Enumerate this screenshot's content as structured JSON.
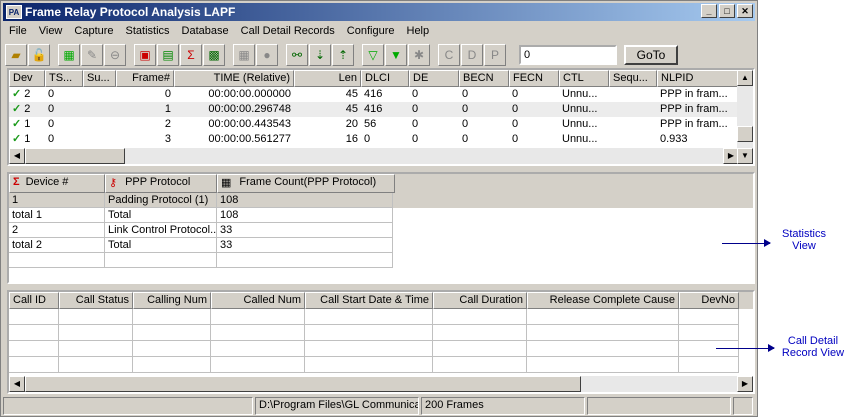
{
  "window": {
    "title": "Frame Relay Protocol Analysis LAPF",
    "logo_text": "PA"
  },
  "menu": [
    {
      "label": "File"
    },
    {
      "label": "View"
    },
    {
      "label": "Capture"
    },
    {
      "label": "Statistics"
    },
    {
      "label": "Database"
    },
    {
      "label": "Call Detail Records"
    },
    {
      "label": "Configure"
    },
    {
      "label": "Help"
    }
  ],
  "toolbar": {
    "goto_value": "0",
    "goto_label": "GoTo"
  },
  "frames": {
    "columns": [
      "Dev",
      "TS...",
      "Su...",
      "Frame#",
      "TIME (Relative)",
      "Len",
      "DLCI",
      "DE",
      "BECN",
      "FECN",
      "CTL",
      "Sequ...",
      "NLPID"
    ],
    "rows": [
      [
        "2",
        "0",
        "",
        "0",
        "00:00:00.000000",
        "45",
        "416",
        "0",
        "0",
        "0",
        "Unnu...",
        "",
        "PPP in fram..."
      ],
      [
        "2",
        "0",
        "",
        "1",
        "00:00:00.296748",
        "45",
        "416",
        "0",
        "0",
        "0",
        "Unnu...",
        "",
        "PPP in fram..."
      ],
      [
        "1",
        "0",
        "",
        "2",
        "00:00:00.443543",
        "20",
        "56",
        "0",
        "0",
        "0",
        "Unnu...",
        "",
        "PPP in fram..."
      ],
      [
        "1",
        "0",
        "",
        "3",
        "00:00:00.561277",
        "16",
        "0",
        "0",
        "0",
        "0",
        "Unnu...",
        "",
        "0.933"
      ]
    ]
  },
  "statistics": {
    "columns": [
      "Device #",
      "PPP Protocol",
      "Frame Count(PPP Protocol)"
    ],
    "rows": [
      [
        "1",
        "Padding Protocol (1)",
        "108"
      ],
      [
        "total 1",
        "Total",
        "108"
      ],
      [
        "2",
        "Link Control Protocol...",
        "33"
      ],
      [
        "total 2",
        "Total",
        "33"
      ]
    ]
  },
  "calls": {
    "columns": [
      "Call ID",
      "Call Status",
      "Calling Num",
      "Called Num",
      "Call Start Date & Time",
      "Call Duration",
      "Release Complete Cause",
      "DevNo"
    ]
  },
  "status": {
    "path": "D:\\Program Files\\GL Communicatic",
    "frames": "200 Frames"
  },
  "annotations": {
    "stats_view_line1": "Statistics",
    "stats_view_line2": "View",
    "cdr_view_line1": "Call Detail",
    "cdr_view_line2": "Record View"
  },
  "colors": {
    "title_bar": "#0a246a",
    "annotation": "#0000c0"
  }
}
